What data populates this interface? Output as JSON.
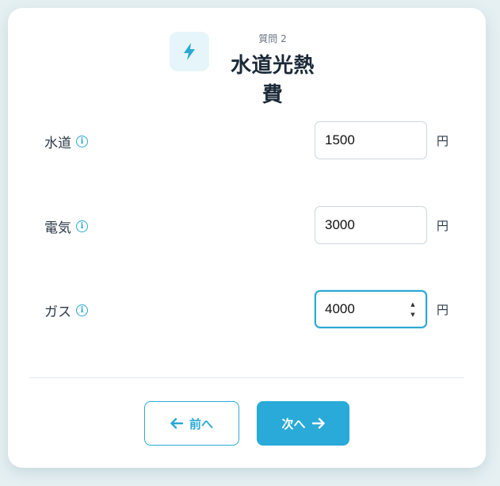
{
  "header": {
    "icon": "lightning-bolt-icon",
    "eyebrow": "質問 2",
    "title": "水道光熱費"
  },
  "fields": [
    {
      "label": "水道",
      "value": "1500",
      "unit": "円",
      "info_icon": "info-icon"
    },
    {
      "label": "電気",
      "value": "3000",
      "unit": "円",
      "info_icon": "info-icon"
    },
    {
      "label": "ガス",
      "value": "4000",
      "unit": "円",
      "info_icon": "info-icon",
      "focused": true
    }
  ],
  "navigation": {
    "prev_label": "前へ",
    "next_label": "次へ",
    "prev_icon": "arrow-left-icon",
    "next_icon": "arrow-right-icon"
  },
  "colors": {
    "accent": "#29aad8",
    "title_text": "#1c2a38",
    "icon_bg": "#e6f5fa",
    "page_bg": "#e6f0f3"
  }
}
